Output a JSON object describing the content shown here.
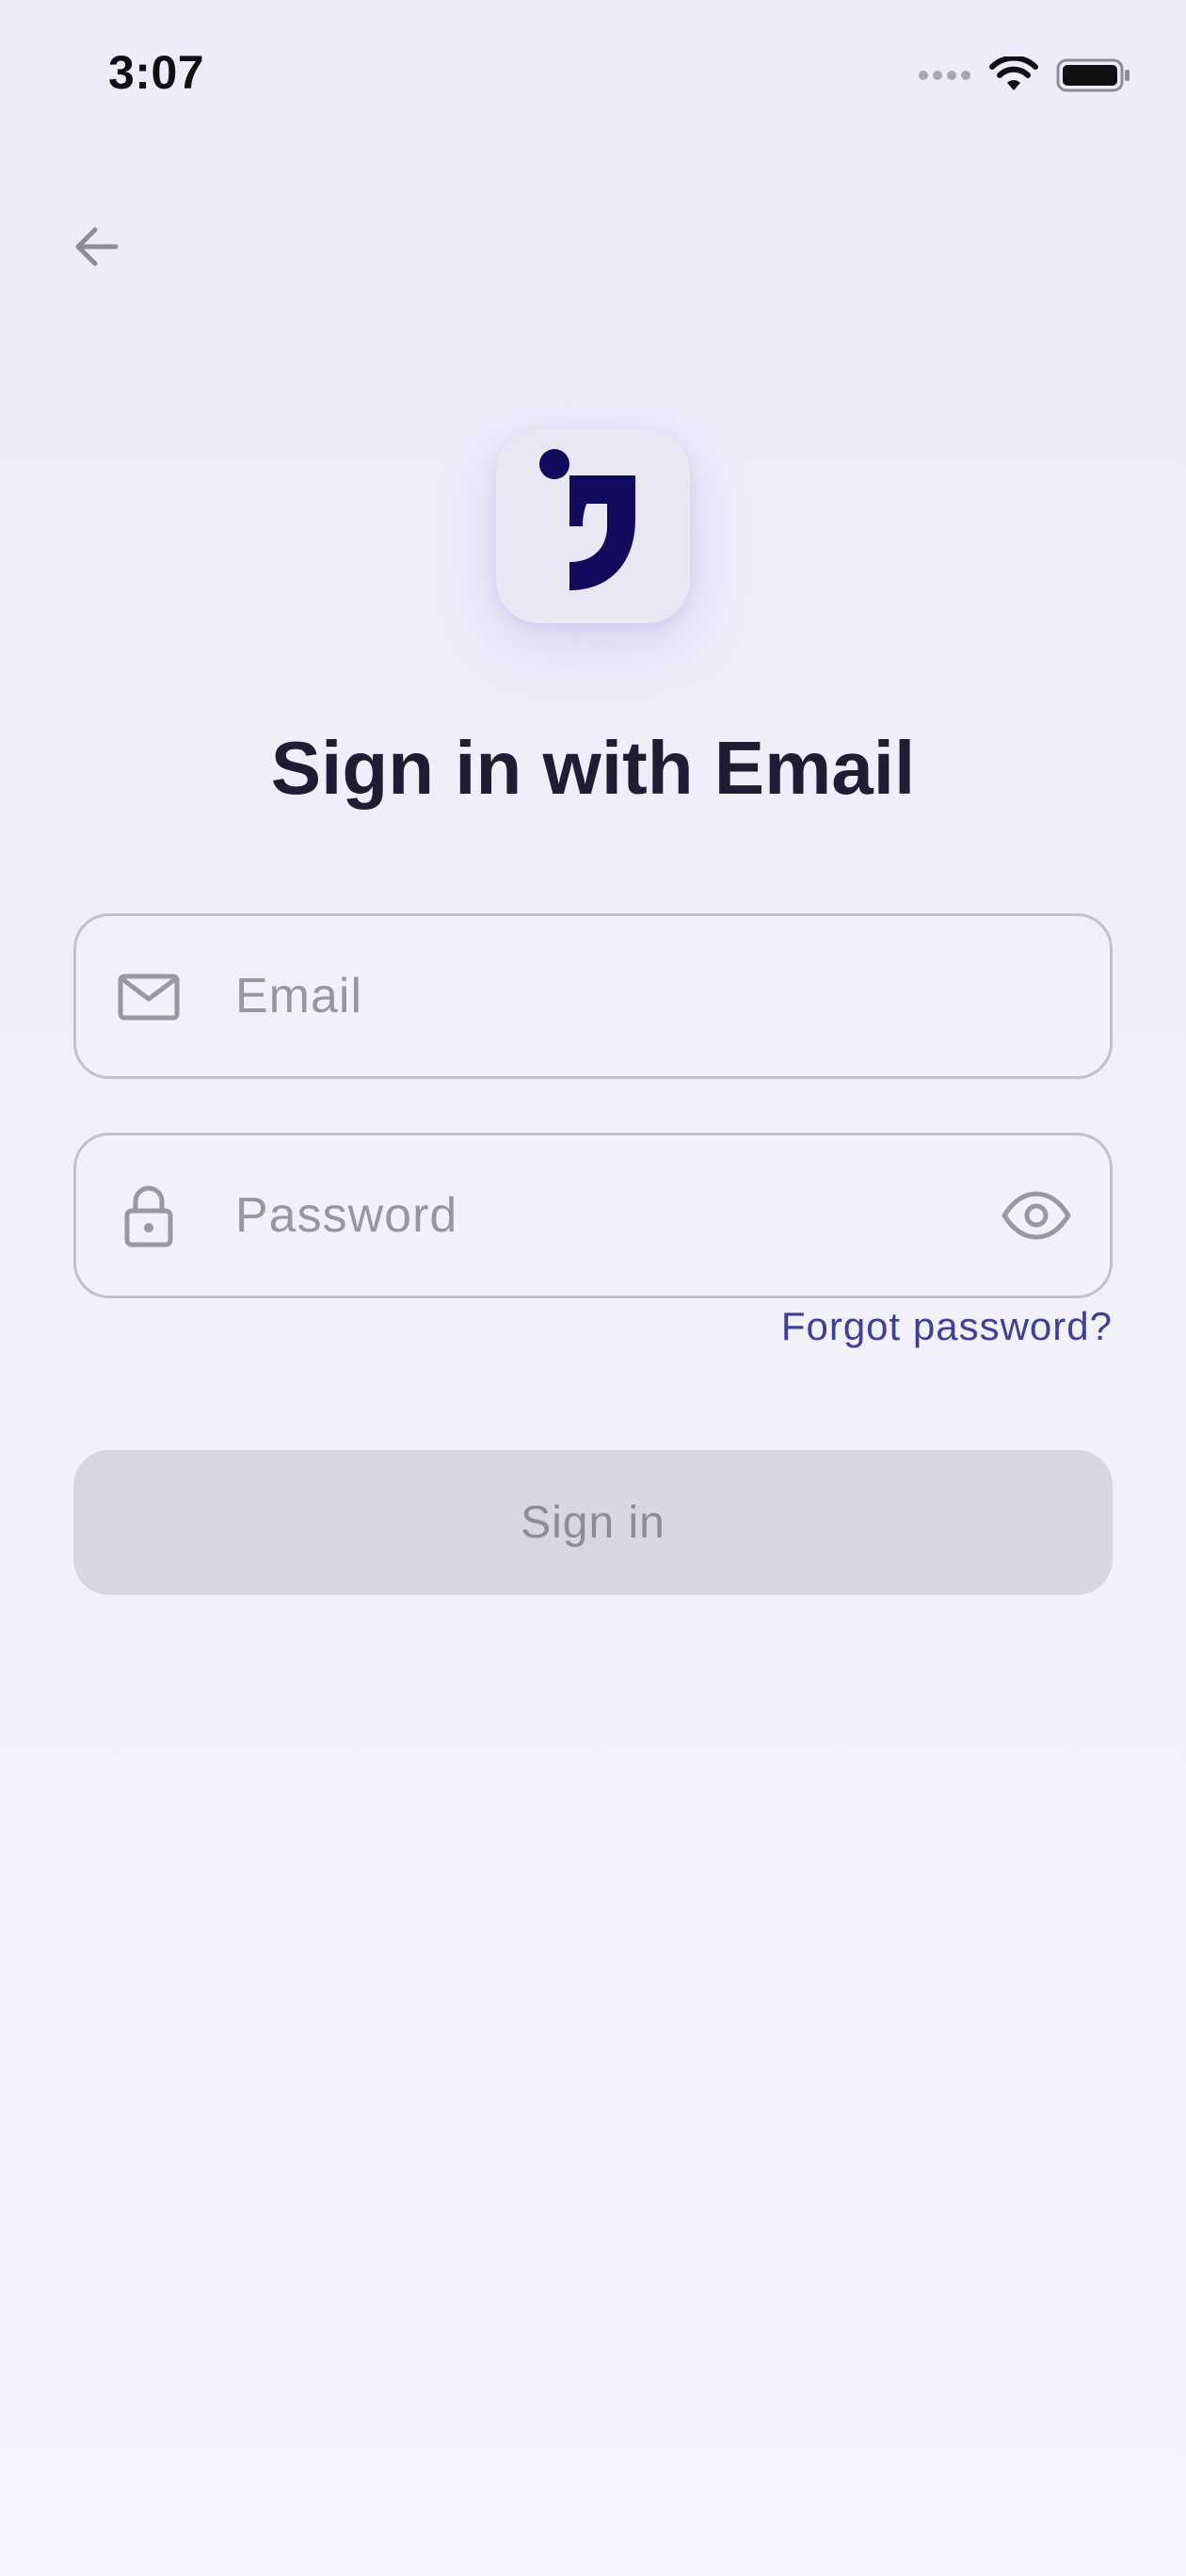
{
  "status_bar": {
    "time": "3:07",
    "icons": [
      "signal-dots-icon",
      "wifi-icon",
      "battery-icon"
    ]
  },
  "nav": {
    "back_icon": "arrow-left-icon"
  },
  "logo": {
    "icon": "brand-logo-icon",
    "brand_color": "#120a5c"
  },
  "title": "Sign in with Email",
  "form": {
    "email": {
      "icon": "mail-icon",
      "placeholder": "Email",
      "value": ""
    },
    "password": {
      "icon": "lock-icon",
      "placeholder": "Password",
      "value": "",
      "toggle_icon": "eye-icon"
    },
    "forgot_password_label": "Forgot password?",
    "submit_label": "Sign in"
  },
  "colors": {
    "background_top": "#eeebfa",
    "background_bottom": "#f5f3fd",
    "title": "#1f1d33",
    "link": "#3f3f9a",
    "button_disabled_bg": "#d9d6e3",
    "button_disabled_text": "#8e8c99",
    "field_border": "#c2bfcf",
    "placeholder": "#9896a3"
  }
}
